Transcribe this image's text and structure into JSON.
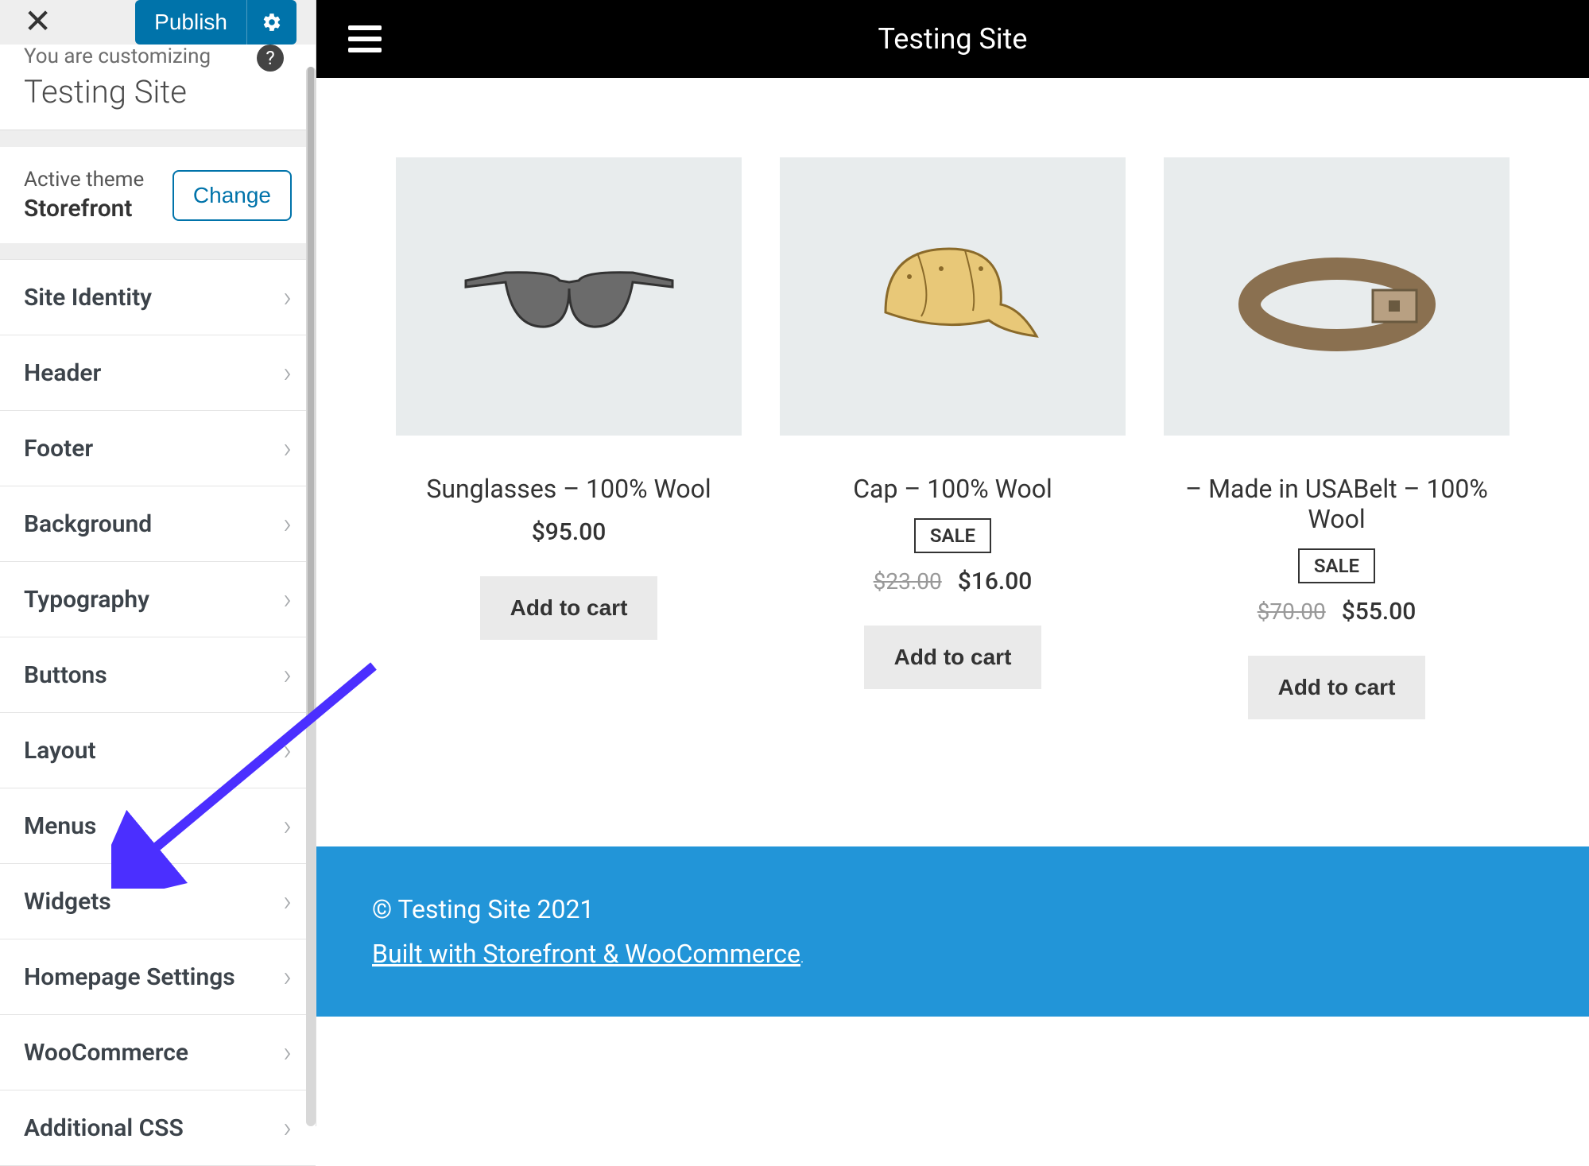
{
  "topbar": {
    "publish_label": "Publish"
  },
  "header": {
    "customizing_label": "You are customizing",
    "site_name": "Testing Site"
  },
  "theme": {
    "active_label": "Active theme",
    "name": "Storefront",
    "change_label": "Change"
  },
  "menu": {
    "items": [
      {
        "label": "Site Identity"
      },
      {
        "label": "Header"
      },
      {
        "label": "Footer"
      },
      {
        "label": "Background"
      },
      {
        "label": "Typography"
      },
      {
        "label": "Buttons"
      },
      {
        "label": "Layout"
      },
      {
        "label": "Menus"
      },
      {
        "label": "Widgets"
      },
      {
        "label": "Homepage Settings"
      },
      {
        "label": "WooCommerce"
      },
      {
        "label": "Additional CSS"
      }
    ]
  },
  "preview": {
    "site_title": "Testing Site"
  },
  "products": [
    {
      "name": "Sunglasses – 100% Wool",
      "price": "$95.00",
      "old_price": null,
      "sale": false,
      "add_label": "Add to cart",
      "icon": "sunglasses"
    },
    {
      "name": "Cap – 100% Wool",
      "price": "$16.00",
      "old_price": "$23.00",
      "sale": true,
      "sale_label": "SALE",
      "add_label": "Add to cart",
      "icon": "cap"
    },
    {
      "name": " – Made in USABelt – 100% Wool",
      "price": "$55.00",
      "old_price": "$70.00",
      "sale": true,
      "sale_label": "SALE",
      "add_label": "Add to cart",
      "icon": "belt"
    }
  ],
  "footer": {
    "copyright": "© Testing Site 2021",
    "credit": "Built with Storefront & WooCommerce"
  },
  "colors": {
    "accent": "#0073aa",
    "footer_bg": "#2295d8",
    "arrow": "#4b2fff"
  }
}
